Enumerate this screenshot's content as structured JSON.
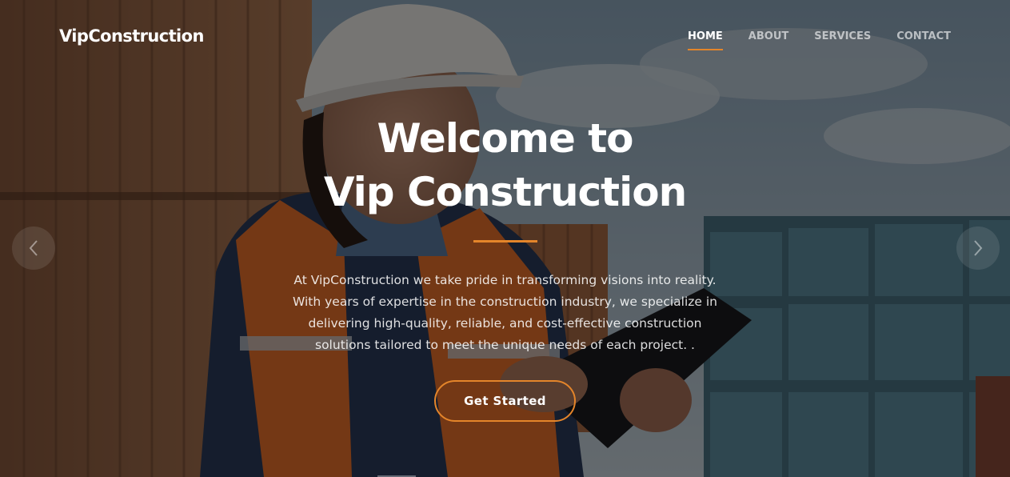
{
  "header": {
    "logo": "VipConstruction",
    "nav": [
      {
        "label": "HOME",
        "active": true
      },
      {
        "label": "ABOUT",
        "active": false
      },
      {
        "label": "SERVICES",
        "active": false
      },
      {
        "label": "CONTACT",
        "active": false
      }
    ]
  },
  "hero": {
    "title_line1": "Welcome to",
    "title_line2": "Vip Construction",
    "description": "At VipConstruction we take pride in transforming visions into reality. With years of expertise in the construction industry, we specialize in delivering high-quality, reliable, and cost-effective construction solutions tailored to meet the unique needs of each project. .",
    "cta_label": "Get Started"
  },
  "carousel": {
    "prev_icon": "chevron-left-icon",
    "next_icon": "chevron-right-icon"
  },
  "colors": {
    "accent": "#e4852a",
    "overlay": "rgba(0,0,0,0.5)"
  }
}
